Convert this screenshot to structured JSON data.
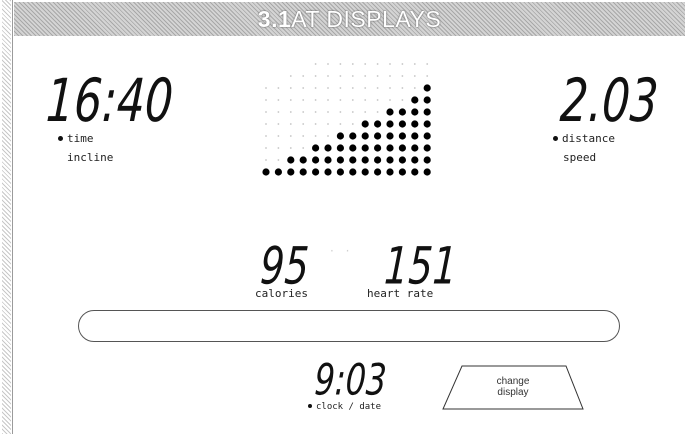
{
  "header": {
    "number": "3.1",
    "title": "AT DISPLAYS"
  },
  "left_display": {
    "value": "16:40",
    "labels": [
      "time",
      "incline"
    ],
    "active_label": "time"
  },
  "right_display": {
    "value": "2.03",
    "labels": [
      "distance",
      "speed"
    ],
    "active_label": "distance"
  },
  "profile_matrix": {
    "columns": 14,
    "rows": 10,
    "lit_heights": [
      1,
      1,
      2,
      2,
      3,
      3,
      4,
      4,
      5,
      5,
      6,
      6,
      7,
      8
    ]
  },
  "calories": {
    "value": "95",
    "label": "calories"
  },
  "heart_rate": {
    "value": "151",
    "label": "heart rate"
  },
  "clock": {
    "value": "9:03",
    "label": "clock / date"
  },
  "change_display_button": {
    "line1": "change",
    "line2": "display"
  }
}
